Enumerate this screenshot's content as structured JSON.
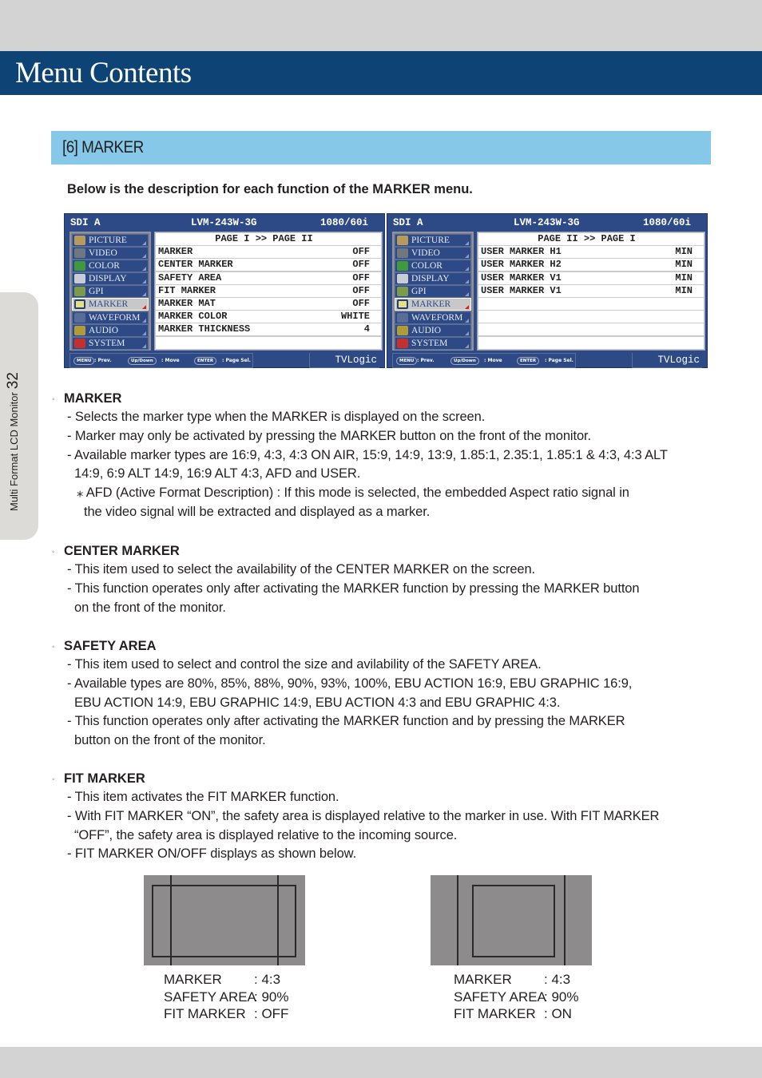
{
  "page": {
    "header_title": "Menu Contents",
    "section_title": "[6] MARKER",
    "side_label": "Multi Format LCD Monitor",
    "page_number": "32",
    "intro": "Below is the description for each function of the MARKER menu."
  },
  "osd_screens": [
    {
      "header": {
        "source": "SDI A",
        "model": "LVM-243W-3G",
        "format": "1080/60i"
      },
      "menu_items": [
        {
          "label": "PICTURE",
          "icon": "picture-palette-icon",
          "selected": false
        },
        {
          "label": "VIDEO",
          "icon": "video-camera-icon",
          "selected": false
        },
        {
          "label": "COLOR",
          "icon": "color-icon",
          "selected": false
        },
        {
          "label": "DISPLAY",
          "icon": "display-monitor-icon",
          "selected": false
        },
        {
          "label": "GPI",
          "icon": "gpi-icon",
          "selected": false
        },
        {
          "label": "MARKER",
          "icon": "marker-square-icon",
          "selected": true
        },
        {
          "label": "WAVEFORM",
          "icon": "waveform-icon",
          "selected": false
        },
        {
          "label": "AUDIO",
          "icon": "audio-gramophone-icon",
          "selected": false
        },
        {
          "label": "SYSTEM",
          "icon": "system-gears-icon",
          "selected": false
        }
      ],
      "page_title": "PAGE I >> PAGE II",
      "rows": [
        {
          "name": "MARKER",
          "value": "OFF"
        },
        {
          "name": "CENTER MARKER",
          "value": "OFF"
        },
        {
          "name": "SAFETY AREA",
          "value": "OFF"
        },
        {
          "name": "FIT MARKER",
          "value": "OFF"
        },
        {
          "name": "MARKER MAT",
          "value": "OFF"
        },
        {
          "name": "MARKER COLOR",
          "value": "WHITE"
        },
        {
          "name": "MARKER THICKNESS",
          "value": "4"
        },
        {
          "name": "",
          "value": ""
        }
      ],
      "footer": {
        "keys": [
          {
            "key": "MENU",
            "action": ": Prev."
          },
          {
            "key": "Up/Down",
            "action": ": Move"
          },
          {
            "key": "ENTER",
            "action": ": Page Sel."
          }
        ],
        "brand": "TVLogic"
      }
    },
    {
      "header": {
        "source": "SDI A",
        "model": "LVM-243W-3G",
        "format": "1080/60i"
      },
      "menu_items": [
        {
          "label": "PICTURE",
          "icon": "picture-palette-icon",
          "selected": false
        },
        {
          "label": "VIDEO",
          "icon": "video-camera-icon",
          "selected": false
        },
        {
          "label": "COLOR",
          "icon": "color-icon",
          "selected": false
        },
        {
          "label": "DISPLAY",
          "icon": "display-monitor-icon",
          "selected": false
        },
        {
          "label": "GPI",
          "icon": "gpi-icon",
          "selected": false
        },
        {
          "label": "MARKER",
          "icon": "marker-square-icon",
          "selected": true
        },
        {
          "label": "WAVEFORM",
          "icon": "waveform-icon",
          "selected": false
        },
        {
          "label": "AUDIO",
          "icon": "audio-gramophone-icon",
          "selected": false
        },
        {
          "label": "SYSTEM",
          "icon": "system-gears-icon",
          "selected": false
        }
      ],
      "page_title": "PAGE II >> PAGE I",
      "rows": [
        {
          "name": "USER MARKER H1",
          "value": "MIN"
        },
        {
          "name": "USER MARKER H2",
          "value": "MIN"
        },
        {
          "name": "USER MARKER V1",
          "value": "MIN"
        },
        {
          "name": "USER MARKER V1",
          "value": "MIN"
        },
        {
          "name": "",
          "value": ""
        },
        {
          "name": "",
          "value": ""
        },
        {
          "name": "",
          "value": ""
        },
        {
          "name": "",
          "value": ""
        }
      ],
      "footer": {
        "keys": [
          {
            "key": "MENU",
            "action": ": Prev."
          },
          {
            "key": "Up/Down",
            "action": ": Move"
          },
          {
            "key": "ENTER",
            "action": ": Page Sel."
          }
        ],
        "brand": "TVLogic"
      }
    }
  ],
  "sections": [
    {
      "heading": "MARKER",
      "lines": [
        {
          "t": "- Selects the marker type when the MARKER is displayed on the screen.",
          "k": ""
        },
        {
          "t": "- Marker may only be activated by pressing the MARKER button on the front of the monitor.",
          "k": ""
        },
        {
          "t": "- Available marker types are 16:9, 4:3, 4:3 ON AIR, 15:9, 14:9, 13:9, 1.85:1, 2.35:1, 1.85:1 & 4:3, 4:3 ALT",
          "k": ""
        },
        {
          "t": "14:9, 6:9 ALT 14:9, 16:9 ALT 4:3, AFD and USER.",
          "k": "cont"
        },
        {
          "t": "⁎ AFD (Active Format Description) : If this mode is selected,  the embedded Aspect ratio signal in",
          "k": "note"
        },
        {
          "t": "the video signal will be extracted and displayed as a marker.",
          "k": "note2"
        }
      ]
    },
    {
      "heading": "CENTER MARKER",
      "lines": [
        {
          "t": "- This item used to select the availability of the CENTER MARKER on the screen.",
          "k": ""
        },
        {
          "t": "- This function operates only after activating the MARKER function by pressing the MARKER button",
          "k": ""
        },
        {
          "t": "on the front of the monitor.",
          "k": "cont"
        }
      ]
    },
    {
      "heading": "SAFETY AREA",
      "lines": [
        {
          "t": "- This item used to select and control the size and avilability of the SAFETY AREA.",
          "k": ""
        },
        {
          "t": "- Available types are 80%, 85%, 88%, 90%, 93%, 100%, EBU ACTION 16:9, EBU GRAPHIC 16:9,",
          "k": ""
        },
        {
          "t": "EBU ACTION 14:9, EBU GRAPHIC 14:9, EBU ACTION 4:3 and EBU GRAPHIC 4:3.",
          "k": "cont"
        },
        {
          "t": "- This function operates only after activating the MARKER function and by pressing the MARKER",
          "k": ""
        },
        {
          "t": "button on the front of the monitor.",
          "k": "cont"
        }
      ]
    },
    {
      "heading": "FIT MARKER",
      "lines": [
        {
          "t": "- This item activates the FIT MARKER function.",
          "k": ""
        },
        {
          "t": "- With FIT MARKER “ON”, the safety area is displayed relative to the marker in use. With FIT MARKER",
          "k": ""
        },
        {
          "t": "“OFF”, the safety area is displayed relative to the incoming source.",
          "k": "cont"
        },
        {
          "t": "- FIT MARKER ON/OFF displays as shown below.",
          "k": ""
        }
      ]
    }
  ],
  "examples": [
    {
      "fit": "off",
      "captions": [
        {
          "key": "MARKER",
          "value": ": 4:3"
        },
        {
          "key": "SAFETY AREA",
          "value": ": 90%"
        },
        {
          "key": "FIT MARKER",
          "value": ": OFF"
        }
      ]
    },
    {
      "fit": "on",
      "captions": [
        {
          "key": "MARKER",
          "value": ": 4:3"
        },
        {
          "key": "SAFETY AREA",
          "value": ": 90%"
        },
        {
          "key": "FIT MARKER",
          "value": ": ON"
        }
      ]
    }
  ]
}
